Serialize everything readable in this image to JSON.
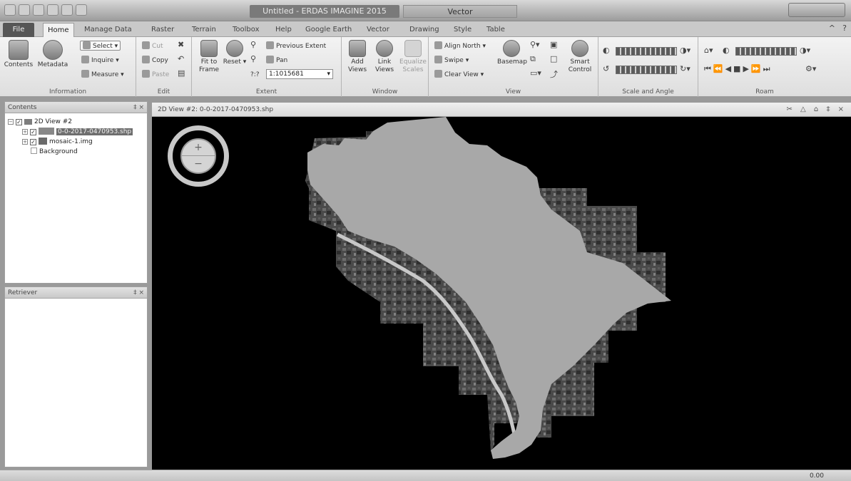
{
  "titlebar": {
    "app_title": "Untitled - ERDAS IMAGINE 2015",
    "context_tab": "Vector"
  },
  "tabs": [
    "File",
    "Home",
    "Manage Data",
    "Raster",
    "Terrain",
    "Toolbox",
    "Help",
    "Google Earth",
    "Vector",
    "Drawing",
    "Style",
    "Table"
  ],
  "ribbon": {
    "information": {
      "label": "Information",
      "contents": "Contents",
      "metadata": "Metadata",
      "select": "Select",
      "inquire": "Inquire",
      "measure": "Measure"
    },
    "edit": {
      "label": "Edit",
      "cut": "Cut",
      "copy": "Copy",
      "paste": "Paste"
    },
    "extent": {
      "label": "Extent",
      "fit_to_frame": "Fit to Frame",
      "reset": "Reset",
      "previous_extent": "Previous Extent",
      "pan": "Pan",
      "scale_prefix": "?:?",
      "scale_value": "1:1015681"
    },
    "window": {
      "label": "Window",
      "add_views": "Add Views",
      "link_views": "Link Views",
      "equalize_scales": "Equalize Scales"
    },
    "view": {
      "label": "View",
      "align_north": "Align North",
      "swipe": "Swipe",
      "clear_view": "Clear View",
      "basemap": "Basemap",
      "smart_control": "Smart Control"
    },
    "scale_angle": {
      "label": "Scale and Angle"
    },
    "roam": {
      "label": "Roam"
    }
  },
  "contents_pane": {
    "title": "Contents",
    "controls": "‡ ×",
    "view_name": "2D View #2",
    "layers": [
      {
        "name": "0-0-2017-0470953.shp",
        "checked": true,
        "selected": true
      },
      {
        "name": "mosaic-1.img",
        "checked": true,
        "selected": false
      }
    ],
    "background": "Background"
  },
  "retriever_pane": {
    "title": "Retriever",
    "controls": "‡ ×"
  },
  "view": {
    "tab_title": "2D View #2: 0-0-2017-0470953.shp",
    "controls": "✂ △ ⌂ ‡ ×"
  },
  "status": {
    "coord": "0.00"
  },
  "colors": {
    "polygon_fill": "#a8a8a8",
    "map_background": "#000000",
    "file_tab": "#565656"
  }
}
